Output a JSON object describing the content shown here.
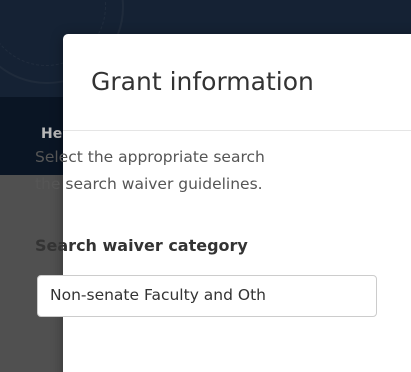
{
  "nav": {
    "item_partial": "He"
  },
  "modal": {
    "title": "Grant information",
    "description_lines": [
      "Select the appropriate search",
      "the search waiver guidelines."
    ],
    "field_label": "Search waiver category",
    "select_value": "Non-senate Faculty and Oth"
  },
  "colors": {
    "header_bg": "#1e3049",
    "nav_bg": "#0f1e33",
    "modal_bg": "#ffffff"
  }
}
